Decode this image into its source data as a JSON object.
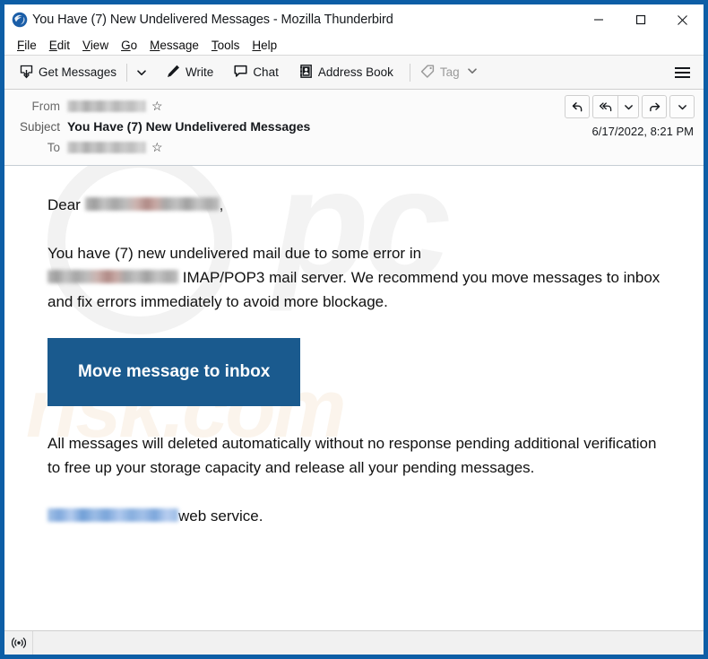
{
  "window": {
    "title": "You Have (7) New Undelivered Messages - Mozilla Thunderbird",
    "logo_icon": "thunderbird-logo-icon",
    "controls": {
      "minimize": "minimize-icon",
      "maximize": "maximize-icon",
      "close": "close-icon"
    }
  },
  "menubar": {
    "items": [
      {
        "label": "File",
        "accesskey": "F"
      },
      {
        "label": "Edit",
        "accesskey": "E"
      },
      {
        "label": "View",
        "accesskey": "V"
      },
      {
        "label": "Go",
        "accesskey": "G"
      },
      {
        "label": "Message",
        "accesskey": "M"
      },
      {
        "label": "Tools",
        "accesskey": "T"
      },
      {
        "label": "Help",
        "accesskey": "H"
      }
    ]
  },
  "toolbar": {
    "get_messages": "Get Messages",
    "get_messages_icon": "download-inbox-icon",
    "get_messages_caret_icon": "chevron-down-icon",
    "write": "Write",
    "write_icon": "pencil-icon",
    "chat": "Chat",
    "chat_icon": "speech-bubble-icon",
    "address_book": "Address Book",
    "address_book_icon": "contact-card-icon",
    "tag": "Tag",
    "tag_icon": "tag-icon",
    "tag_caret_icon": "chevron-down-icon",
    "tag_disabled": true,
    "app_menu_icon": "hamburger-menu-icon"
  },
  "message_header": {
    "from_label": "From",
    "from_value_redacted": true,
    "subject_label": "Subject",
    "subject_value": "You Have (7) New Undelivered Messages",
    "to_label": "To",
    "to_value_redacted": true,
    "star_icon": "star-outline-icon",
    "date": "6/17/2022, 8:21 PM",
    "actions": {
      "reply_icon": "reply-arrow-icon",
      "reply_all_icon": "reply-all-arrow-icon",
      "reply_all_caret_icon": "chevron-down-icon",
      "forward_icon": "forward-arrow-icon",
      "more_caret_icon": "chevron-down-icon"
    }
  },
  "body": {
    "greeting_prefix": "Dear",
    "greeting_suffix": ",",
    "paragraph1_part1": "You have (7) new undelivered mail due to some error in",
    "paragraph1_part2": "IMAP/POP3 mail server. We recommend you move messages to inbox and fix errors immediately to avoid more blockage.",
    "cta_label": "Move message to inbox",
    "cta_color": "#1a5a8e",
    "paragraph2": "All messages will deleted automatically without no response pending additional verification to free up your storage capacity and release all your pending messages.",
    "signature_suffix": "web service.",
    "watermark_text_1": "pc",
    "watermark_text_2": "risk.com"
  },
  "statusbar": {
    "connection_icon": "broadcast-signal-icon"
  }
}
